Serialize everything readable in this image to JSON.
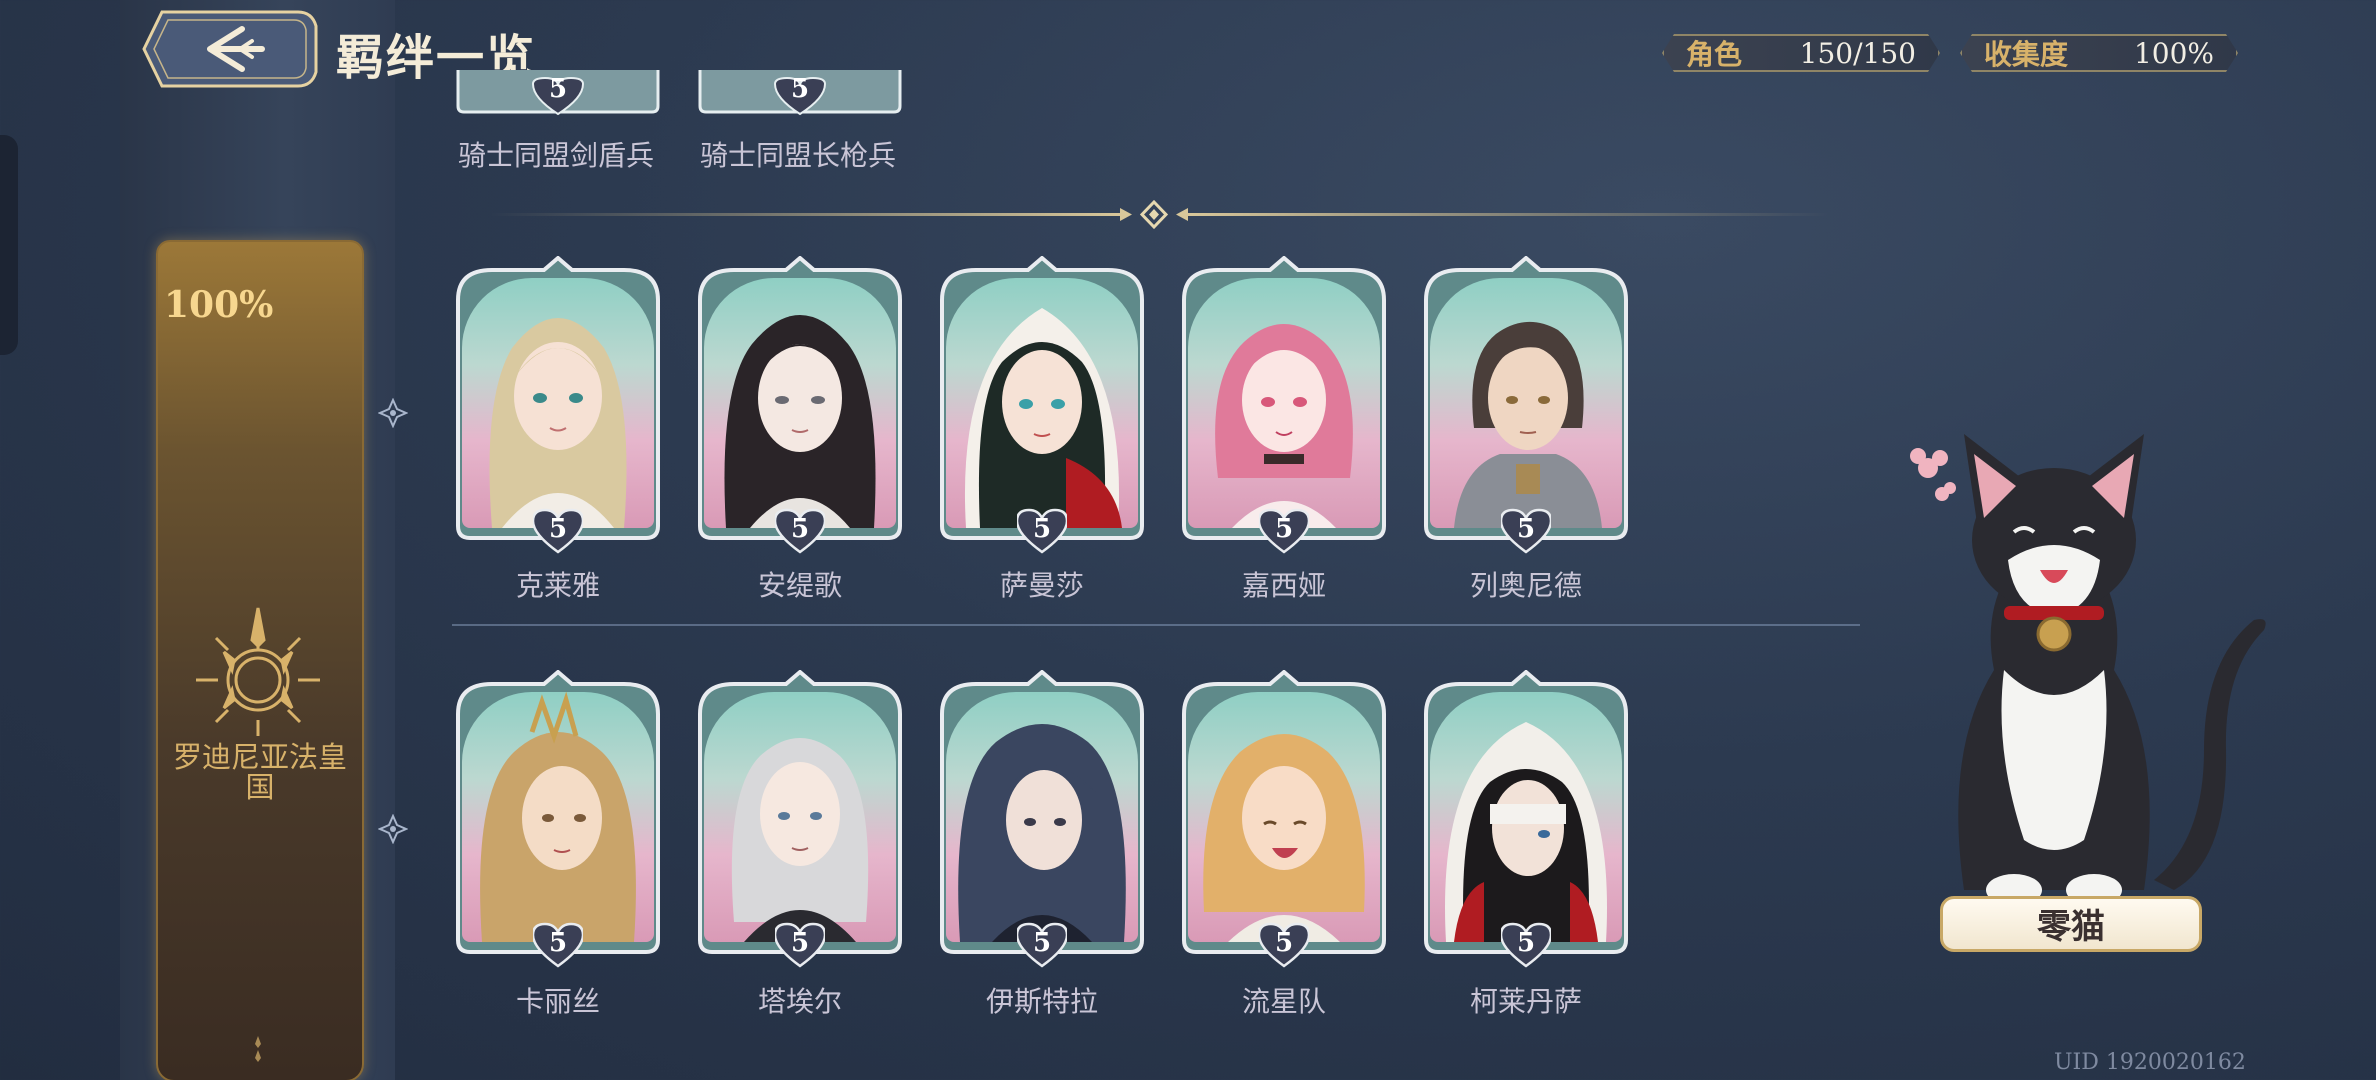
{
  "header": {
    "title": "羁绊一览",
    "stats": [
      {
        "label": "角色",
        "value": "150/150"
      },
      {
        "label": "收集度",
        "value": "100%"
      }
    ]
  },
  "faction": {
    "percent": "100%",
    "name": "罗迪尼亚法皇国"
  },
  "top_row_partial": [
    {
      "level": "5",
      "name": "骑士同盟剑盾兵"
    },
    {
      "level": "5",
      "name": "骑士同盟长枪兵"
    }
  ],
  "rows": [
    [
      {
        "name": "克莱雅",
        "level": "5",
        "hair": "#d9c9a0"
      },
      {
        "name": "安缇歌",
        "level": "5",
        "hair": "#2a2428"
      },
      {
        "name": "萨曼莎",
        "level": "5",
        "hair": "#1e2a26"
      },
      {
        "name": "嘉西娅",
        "level": "5",
        "hair": "#e07a9a"
      },
      {
        "name": "列奥尼德",
        "level": "5",
        "hair": "#4a3e3a"
      }
    ],
    [
      {
        "name": "卡丽丝",
        "level": "5",
        "hair": "#c9a46a"
      },
      {
        "name": "塔埃尔",
        "level": "5",
        "hair": "#d8d8da"
      },
      {
        "name": "伊斯特拉",
        "level": "5",
        "hair": "#3a4660"
      },
      {
        "name": "流星队",
        "level": "5",
        "hair": "#e2b06a"
      },
      {
        "name": "柯莱丹萨",
        "level": "5",
        "hair": "#1c1a1c"
      }
    ]
  ],
  "companion": {
    "name": "零猫"
  },
  "uid": "UID 1920020162"
}
